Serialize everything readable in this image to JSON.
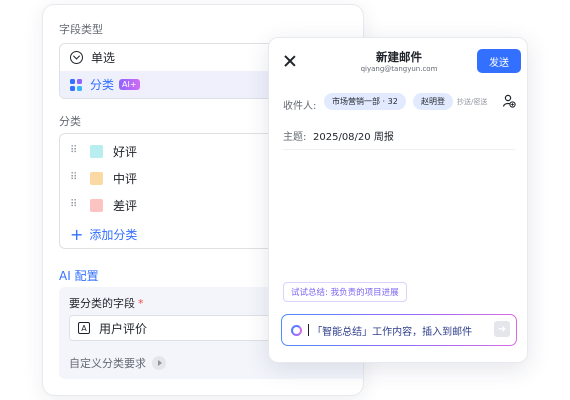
{
  "field_type": {
    "label": "字段类型",
    "options": [
      {
        "label": "单选",
        "icon": "radio-check-icon",
        "selected": false
      },
      {
        "label": "分类",
        "icon": "category-grid-icon",
        "selected": true,
        "badge": "AI+"
      }
    ]
  },
  "categories": {
    "label": "分类",
    "items": [
      {
        "label": "好评",
        "color": "#b8eef0"
      },
      {
        "label": "中评",
        "color": "#fbd9a2"
      },
      {
        "label": "差评",
        "color": "#fbc4c2"
      }
    ],
    "add_label": "添加分类"
  },
  "ai_config": {
    "title": "AI 配置",
    "field_label": "要分类的字段",
    "required_mark": "*",
    "field_value": "用户评价",
    "custom_label": "自定义分类要求"
  },
  "email": {
    "title": "新建邮件",
    "sender": "qiyang@tangyun.com",
    "send_label": "发送",
    "recipient_label": "收件人:",
    "recipients": [
      "市场营销一部 · 32",
      "赵明登"
    ],
    "cc_label": "抄送/密送",
    "subject_label": "主题:",
    "subject_value": "2025/08/20 周报",
    "suggestion": "试试总结: 我负责的项目进展",
    "prompt": "「智能总结」工作内容，插入到邮件"
  },
  "colors": {
    "accent": "#3370ff",
    "ai_purple": "#7b67ee"
  }
}
